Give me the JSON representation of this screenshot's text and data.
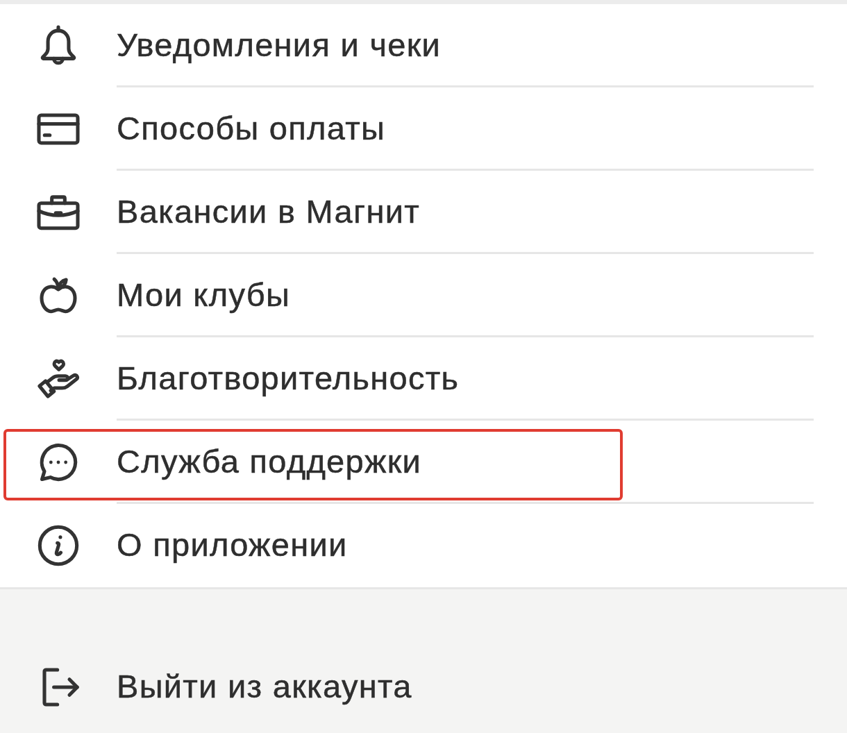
{
  "menu": {
    "items": [
      {
        "label": "Уведомления и чеки",
        "highlighted": false
      },
      {
        "label": "Способы оплаты",
        "highlighted": false
      },
      {
        "label": "Вакансии в Магнит",
        "highlighted": false
      },
      {
        "label": "Мои клубы",
        "highlighted": false
      },
      {
        "label": "Благотворительность",
        "highlighted": false
      },
      {
        "label": "Служба поддержки",
        "highlighted": true
      },
      {
        "label": "О приложении",
        "highlighted": false
      }
    ]
  },
  "logout": {
    "label": "Выйти из аккаунта"
  }
}
